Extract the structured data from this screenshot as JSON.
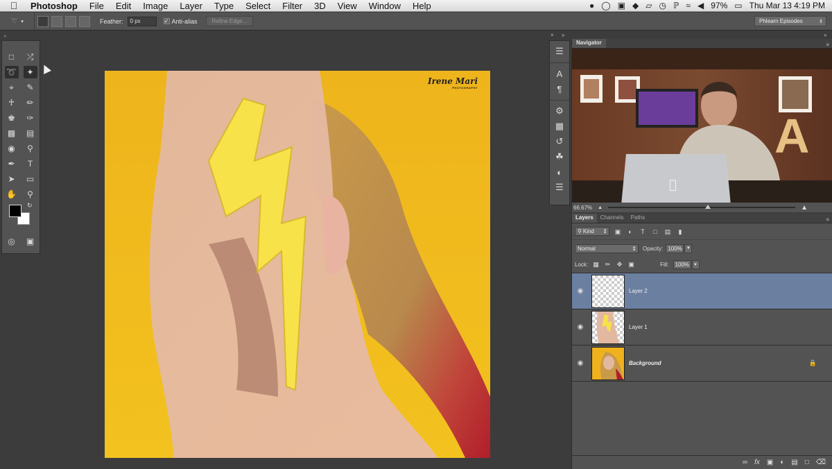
{
  "menubar": {
    "app": "Photoshop",
    "items": [
      "File",
      "Edit",
      "Image",
      "Layer",
      "Type",
      "Select",
      "Filter",
      "3D",
      "View",
      "Window",
      "Help"
    ],
    "battery": "97%",
    "clock": "Thu Mar 13  4:19 PM"
  },
  "options": {
    "feather_label": "Feather:",
    "feather_value": "0 px",
    "antialias_label": "Anti-alias",
    "refine_label": "Refine Edge...",
    "workspace": "Phlearn Episodes"
  },
  "canvas": {
    "watermark_name": "Irene Mari",
    "watermark_sub": "PHOTOGRAPHY"
  },
  "navigator": {
    "tab": "Navigator",
    "zoom": "66.67%"
  },
  "layers": {
    "tabs": [
      "Layers",
      "Channels",
      "Paths"
    ],
    "kind": "Kind",
    "blend_mode": "Normal",
    "opacity_label": "Opacity:",
    "opacity": "100%",
    "lock_label": "Lock:",
    "fill_label": "Fill:",
    "fill": "100%",
    "list": [
      {
        "name": "Layer 2"
      },
      {
        "name": "Layer 1"
      },
      {
        "name": "Background"
      }
    ]
  }
}
